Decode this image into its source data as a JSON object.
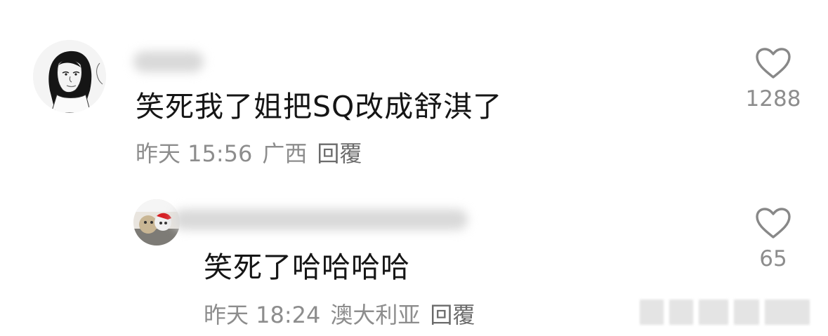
{
  "comments": [
    {
      "text": "笑死我了姐把SQ改成舒淇了",
      "date": "昨天 15:56",
      "location": "广西",
      "reply_label": "回覆",
      "likes": "1288"
    },
    {
      "text": "笑死了哈哈哈哈",
      "date": "昨天 18:24",
      "location": "澳大利亚",
      "reply_label": "回覆",
      "likes": "65"
    }
  ],
  "icons": {
    "like": "heart-outline-icon"
  },
  "colors": {
    "text": "#151515",
    "meta": "#8d8d8d",
    "icon": "#888888"
  }
}
